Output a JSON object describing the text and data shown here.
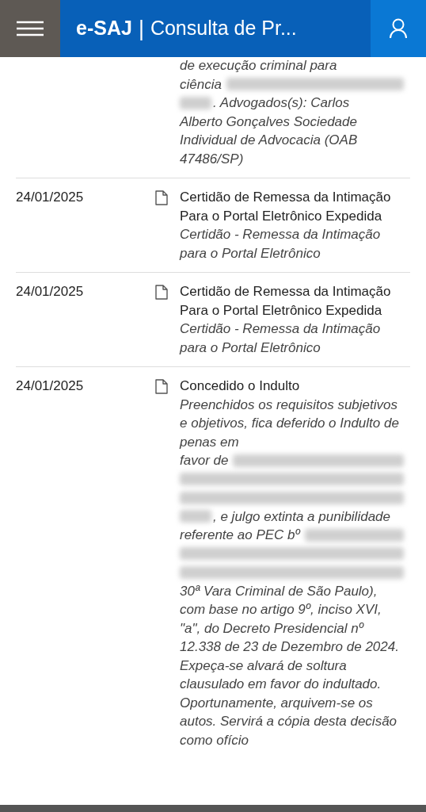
{
  "header": {
    "brand": "e-SAJ",
    "separator": "|",
    "title": "Consulta de Pr..."
  },
  "movements": [
    {
      "description": [
        {
          "kind": "text",
          "text": "de execução criminal para"
        },
        {
          "kind": "row",
          "parts": [
            {
              "kind": "text",
              "text": "ciência"
            },
            {
              "kind": "redacted"
            }
          ]
        },
        {
          "kind": "row",
          "parts": [
            {
              "kind": "redacted"
            },
            {
              "kind": "text",
              "text": ". Advogados(s): Carlos"
            }
          ]
        },
        {
          "kind": "text",
          "text": "Alberto Gonçalves Sociedade Individual de Advocacia (OAB 47486/SP)"
        }
      ]
    },
    {
      "date": "24/01/2025",
      "title": "Certidão de Remessa da Intimação Para o Portal Eletrônico Expedida",
      "description": [
        {
          "kind": "text",
          "text": "Certidão - Remessa da Intimação para o Portal Eletrônico"
        }
      ]
    },
    {
      "date": "24/01/2025",
      "title": "Certidão de Remessa da Intimação Para o Portal Eletrônico Expedida",
      "description": [
        {
          "kind": "text",
          "text": "Certidão - Remessa da Intimação para o Portal Eletrônico"
        }
      ]
    },
    {
      "date": "24/01/2025",
      "title": "Concedido o Indulto",
      "description": [
        {
          "kind": "text",
          "text": "Preenchidos os requisitos subjetivos e objetivos, fica deferido o Indulto de penas em"
        },
        {
          "kind": "row",
          "parts": [
            {
              "kind": "text",
              "text": "favor de"
            },
            {
              "kind": "redacted"
            }
          ]
        },
        {
          "kind": "row",
          "parts": [
            {
              "kind": "redacted"
            }
          ]
        },
        {
          "kind": "row",
          "parts": [
            {
              "kind": "redacted"
            }
          ]
        },
        {
          "kind": "row",
          "parts": [
            {
              "kind": "redacted"
            },
            {
              "kind": "text",
              "text": ", e julgo extinta a punibilidade"
            }
          ]
        },
        {
          "kind": "row",
          "parts": [
            {
              "kind": "text",
              "text": "referente ao PEC bº"
            },
            {
              "kind": "redacted"
            }
          ]
        },
        {
          "kind": "row",
          "parts": [
            {
              "kind": "redacted"
            }
          ]
        },
        {
          "kind": "row",
          "parts": [
            {
              "kind": "redacted"
            }
          ]
        },
        {
          "kind": "text",
          "text": "30ª Vara Criminal de São Paulo), com base no artigo 9º, inciso XVI, \"a\", do Decreto Presidencial nº 12.338 de 23 de Dezembro de 2024. Expeça-se alvará de soltura clausulado em favor do indultado. Oportunamente, arquivem-se os autos. Servirá a cópia desta decisão como ofício"
        }
      ]
    }
  ]
}
